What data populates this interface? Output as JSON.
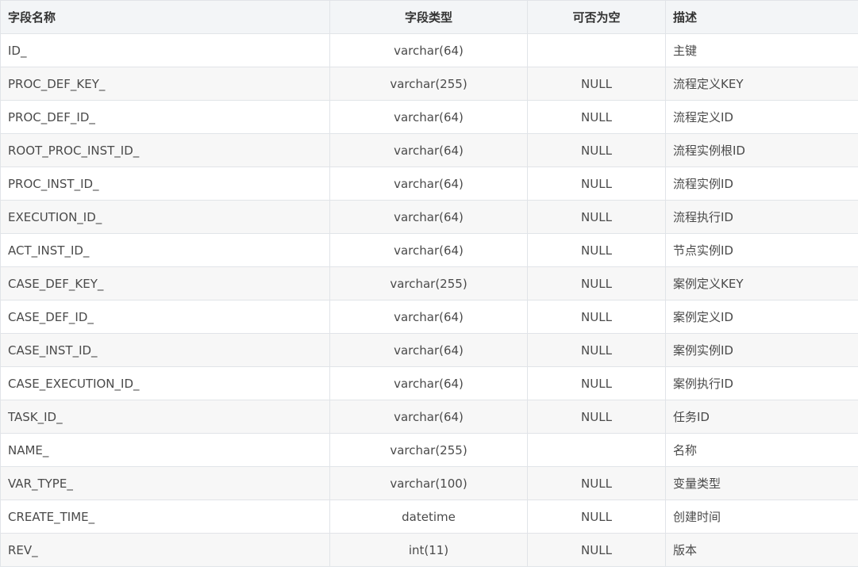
{
  "table": {
    "headers": [
      "字段名称",
      "字段类型",
      "可否为空",
      "描述"
    ],
    "rows": [
      [
        "ID_",
        "varchar(64)",
        "",
        "主键"
      ],
      [
        "PROC_DEF_KEY_",
        "varchar(255)",
        "NULL",
        "流程定义KEY"
      ],
      [
        "PROC_DEF_ID_",
        "varchar(64)",
        "NULL",
        "流程定义ID"
      ],
      [
        "ROOT_PROC_INST_ID_",
        "varchar(64)",
        "NULL",
        "流程实例根ID"
      ],
      [
        "PROC_INST_ID_",
        "varchar(64)",
        "NULL",
        "流程实例ID"
      ],
      [
        "EXECUTION_ID_",
        "varchar(64)",
        "NULL",
        "流程执行ID"
      ],
      [
        "ACT_INST_ID_",
        "varchar(64)",
        "NULL",
        "节点实例ID"
      ],
      [
        "CASE_DEF_KEY_",
        "varchar(255)",
        "NULL",
        "案例定义KEY"
      ],
      [
        "CASE_DEF_ID_",
        "varchar(64)",
        "NULL",
        "案例定义ID"
      ],
      [
        "CASE_INST_ID_",
        "varchar(64)",
        "NULL",
        "案例实例ID"
      ],
      [
        "CASE_EXECUTION_ID_",
        "varchar(64)",
        "NULL",
        "案例执行ID"
      ],
      [
        "TASK_ID_",
        "varchar(64)",
        "NULL",
        "任务ID"
      ],
      [
        "NAME_",
        "varchar(255)",
        "",
        "名称"
      ],
      [
        "VAR_TYPE_",
        "varchar(100)",
        "NULL",
        "变量类型"
      ],
      [
        "CREATE_TIME_",
        "datetime",
        "NULL",
        "创建时间"
      ],
      [
        "REV_",
        "int(11)",
        "NULL",
        "版本"
      ]
    ]
  }
}
